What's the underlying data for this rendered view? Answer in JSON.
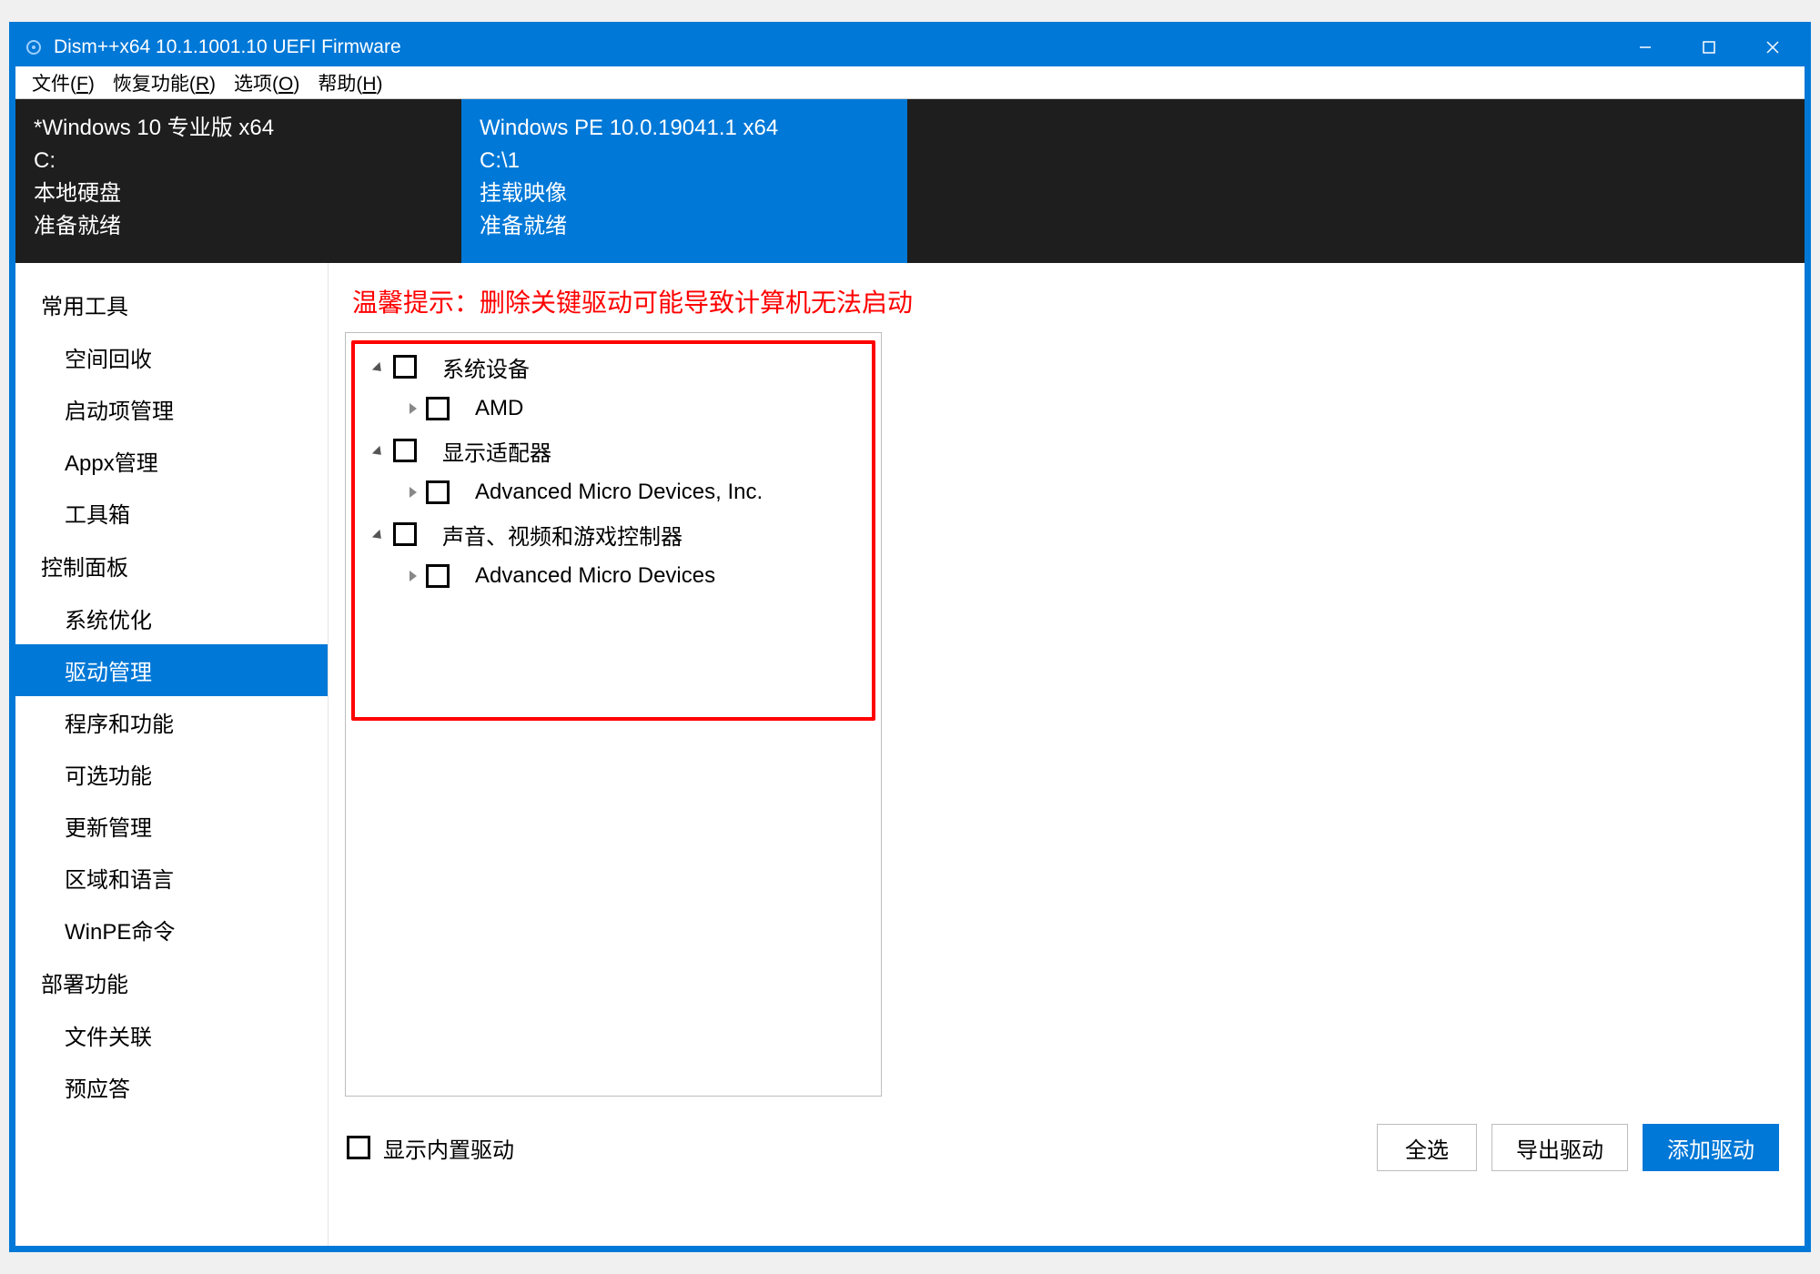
{
  "titlebar": {
    "title": "Dism++x64 10.1.1001.10 UEFI Firmware"
  },
  "menubar": {
    "items": [
      {
        "label": "文件",
        "key": "F"
      },
      {
        "label": "恢复功能",
        "key": "R"
      },
      {
        "label": "选项",
        "key": "O"
      },
      {
        "label": "帮助",
        "key": "H"
      }
    ]
  },
  "os_tabs": [
    {
      "selected": false,
      "lines": [
        "*Windows 10 专业版 x64",
        "C:",
        "本地硬盘",
        "准备就绪"
      ]
    },
    {
      "selected": true,
      "lines": [
        "Windows PE 10.0.19041.1 x64",
        "C:\\1",
        "挂载映像",
        "准备就绪"
      ]
    }
  ],
  "sidebar": {
    "groups": [
      {
        "title": "常用工具",
        "items": [
          {
            "id": "space-recycle",
            "label": "空间回收"
          },
          {
            "id": "startup-mgmt",
            "label": "启动项管理"
          },
          {
            "id": "appx-mgmt",
            "label": "Appx管理"
          },
          {
            "id": "toolbox",
            "label": "工具箱"
          }
        ]
      },
      {
        "title": "控制面板",
        "items": [
          {
            "id": "system-opt",
            "label": "系统优化"
          },
          {
            "id": "driver-mgmt",
            "label": "驱动管理",
            "selected": true
          },
          {
            "id": "programs",
            "label": "程序和功能"
          },
          {
            "id": "optional",
            "label": "可选功能"
          },
          {
            "id": "updates",
            "label": "更新管理"
          },
          {
            "id": "region",
            "label": "区域和语言"
          },
          {
            "id": "winpe",
            "label": "WinPE命令"
          }
        ]
      },
      {
        "title": "部署功能",
        "items": [
          {
            "id": "file-assoc",
            "label": "文件关联"
          },
          {
            "id": "unattend",
            "label": "预应答"
          }
        ]
      }
    ]
  },
  "content": {
    "warning": "温馨提示：删除关键驱动可能导致计算机无法启动",
    "tree": [
      {
        "level": 0,
        "expanded": true,
        "label": "系统设备"
      },
      {
        "level": 1,
        "expanded": false,
        "label": "AMD"
      },
      {
        "level": 0,
        "expanded": true,
        "label": "显示适配器"
      },
      {
        "level": 1,
        "expanded": false,
        "label": "Advanced Micro Devices, Inc."
      },
      {
        "level": 0,
        "expanded": true,
        "label": "声音、视频和游戏控制器"
      },
      {
        "level": 1,
        "expanded": false,
        "label": "Advanced Micro Devices"
      }
    ],
    "show_builtin_label": "显示内置驱动",
    "buttons": {
      "select_all": "全选",
      "export": "导出驱动",
      "add": "添加驱动"
    }
  }
}
